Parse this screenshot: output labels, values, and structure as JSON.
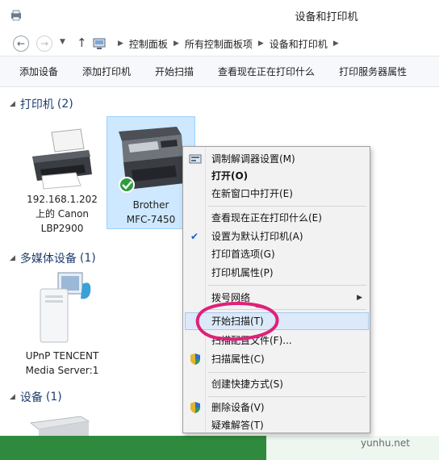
{
  "window": {
    "title": "设备和打印机"
  },
  "address": {
    "crumbs": [
      "控制面板",
      "所有控制面板项",
      "设备和打印机"
    ]
  },
  "toolbar": {
    "items": [
      "添加设备",
      "添加打印机",
      "开始扫描",
      "查看现在正在打印什么",
      "打印服务器属性"
    ]
  },
  "groups": {
    "printers": {
      "name": "打印机",
      "count": "(2)"
    },
    "multimedia": {
      "name": "多媒体设备",
      "count": "(1)"
    },
    "devices": {
      "name": "设备",
      "count": "(1)"
    }
  },
  "devices": {
    "canon": {
      "line1": "192.168.1.202",
      "line2": "上的 Canon",
      "line3": "LBP2900"
    },
    "brother": {
      "line1": "Brother",
      "line2": "MFC-7450"
    },
    "upnp": {
      "line1": "UPnP TENCENT",
      "line2": "Media Server:1"
    }
  },
  "context_menu": {
    "items": [
      "调制解调器设置(M)",
      "打开(O)",
      "在新窗口中打开(E)",
      "查看现在正在打印什么(E)",
      "设置为默认打印机(A)",
      "打印首选项(G)",
      "打印机属性(P)",
      "拨号网络",
      "开始扫描(T)",
      "扫描配置文件(F)...",
      "扫描属性(C)",
      "创建快捷方式(S)",
      "删除设备(V)",
      "疑难解答(T)"
    ],
    "default_item_checked": true
  },
  "watermark": {
    "text": "yunhu.net"
  },
  "colors": {
    "selection": "#cde8ff",
    "menu_hover": "#dbe9f9",
    "annotation": "#e0207a",
    "group_header": "#1e3d6e"
  }
}
